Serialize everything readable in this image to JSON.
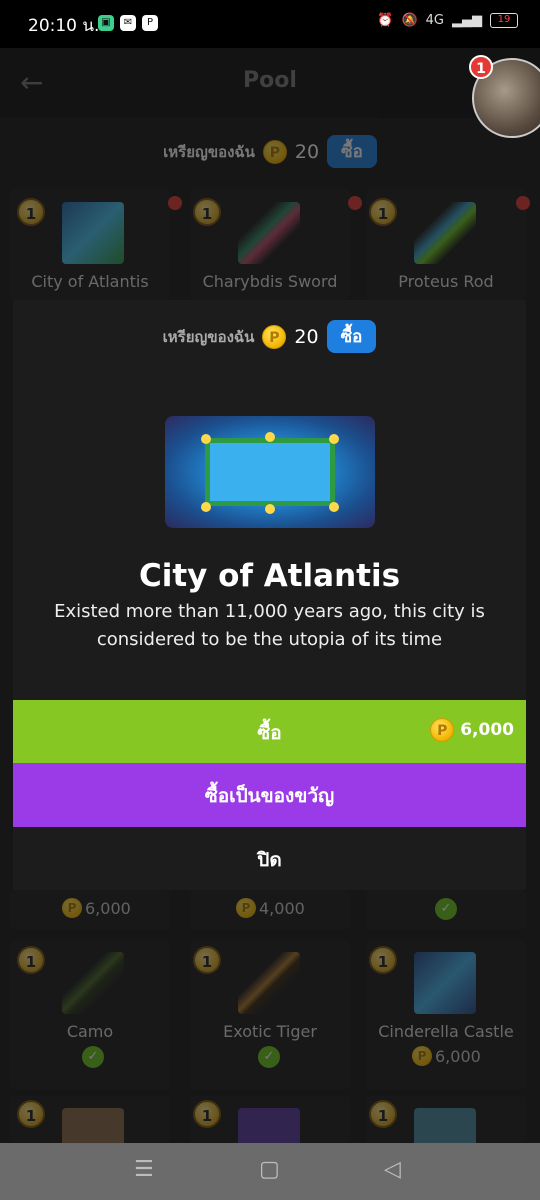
{
  "status_bar": {
    "time": "20:10 น.",
    "battery": "19",
    "signal_text": "4G"
  },
  "header": {
    "title": "Pool",
    "notification_count": "1"
  },
  "coins": {
    "label": "เหรียญของฉัน",
    "amount": "20",
    "buy_label": "ซื้อ",
    "coin_symbol": "P"
  },
  "grid": {
    "badge": "1",
    "row1": [
      "City of Atlantis",
      "Charybdis Sword",
      "Proteus Rod"
    ],
    "row2_prices": [
      "6,000",
      "4,000"
    ],
    "row3": [
      {
        "name": "Camo",
        "owned": true
      },
      {
        "name": "Exotic Tiger",
        "owned": true
      },
      {
        "name": "Cinderella Castle",
        "price": "6,000"
      }
    ]
  },
  "modal": {
    "coins_label": "เหรียญของฉัน",
    "coins_amount": "20",
    "buy_label": "ซื้อ",
    "item_title": "City of Atlantis",
    "item_desc": "Existed more than 11,000 years ago, this city is considered to be the utopia of its time",
    "buy_button": "ซื้อ",
    "price": "6,000",
    "gift_button": "ซื้อเป็นของขวัญ",
    "close_button": "ปิด"
  },
  "colors": {
    "buy_green": "#86c723",
    "gift_purple": "#9b3be8",
    "coin_gold": "#f2b300",
    "accent_blue": "#1f7fe0"
  }
}
